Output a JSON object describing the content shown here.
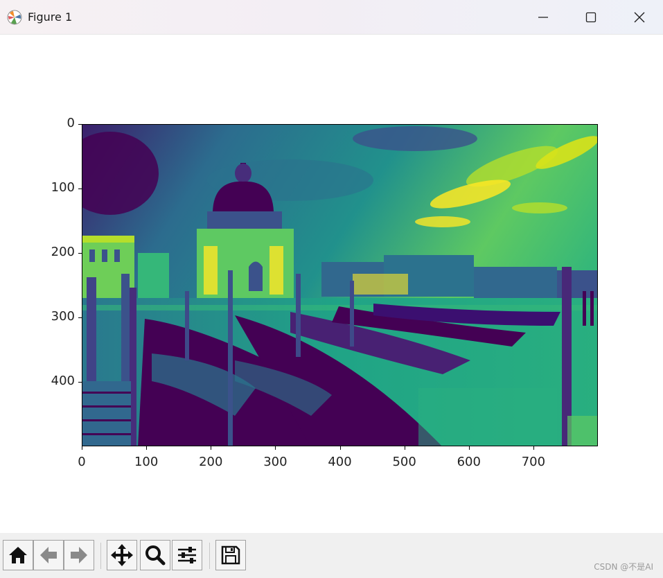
{
  "window": {
    "title": "Figure 1",
    "controls": [
      "minimize-icon",
      "maximize-icon",
      "close-icon"
    ]
  },
  "figure": {
    "image_description_colormap": "viridis",
    "y_ticks": [
      "0",
      "100",
      "200",
      "300",
      "400"
    ],
    "x_ticks": [
      "0",
      "100",
      "200",
      "300",
      "400",
      "500",
      "600",
      "700"
    ]
  },
  "toolbar": {
    "buttons": [
      {
        "name": "home-icon"
      },
      {
        "name": "back-arrow-icon"
      },
      {
        "name": "forward-arrow-icon"
      },
      {
        "name": "pan-move-icon"
      },
      {
        "name": "zoom-magnifier-icon"
      },
      {
        "name": "configure-subplots-icon"
      },
      {
        "name": "save-disk-icon"
      }
    ]
  },
  "watermark": "CSDN @不是AI",
  "colors": {
    "viridis_dark": "#440154",
    "viridis_mid": "#21918c",
    "viridis_light": "#5ec962",
    "viridis_bright": "#fde725"
  }
}
